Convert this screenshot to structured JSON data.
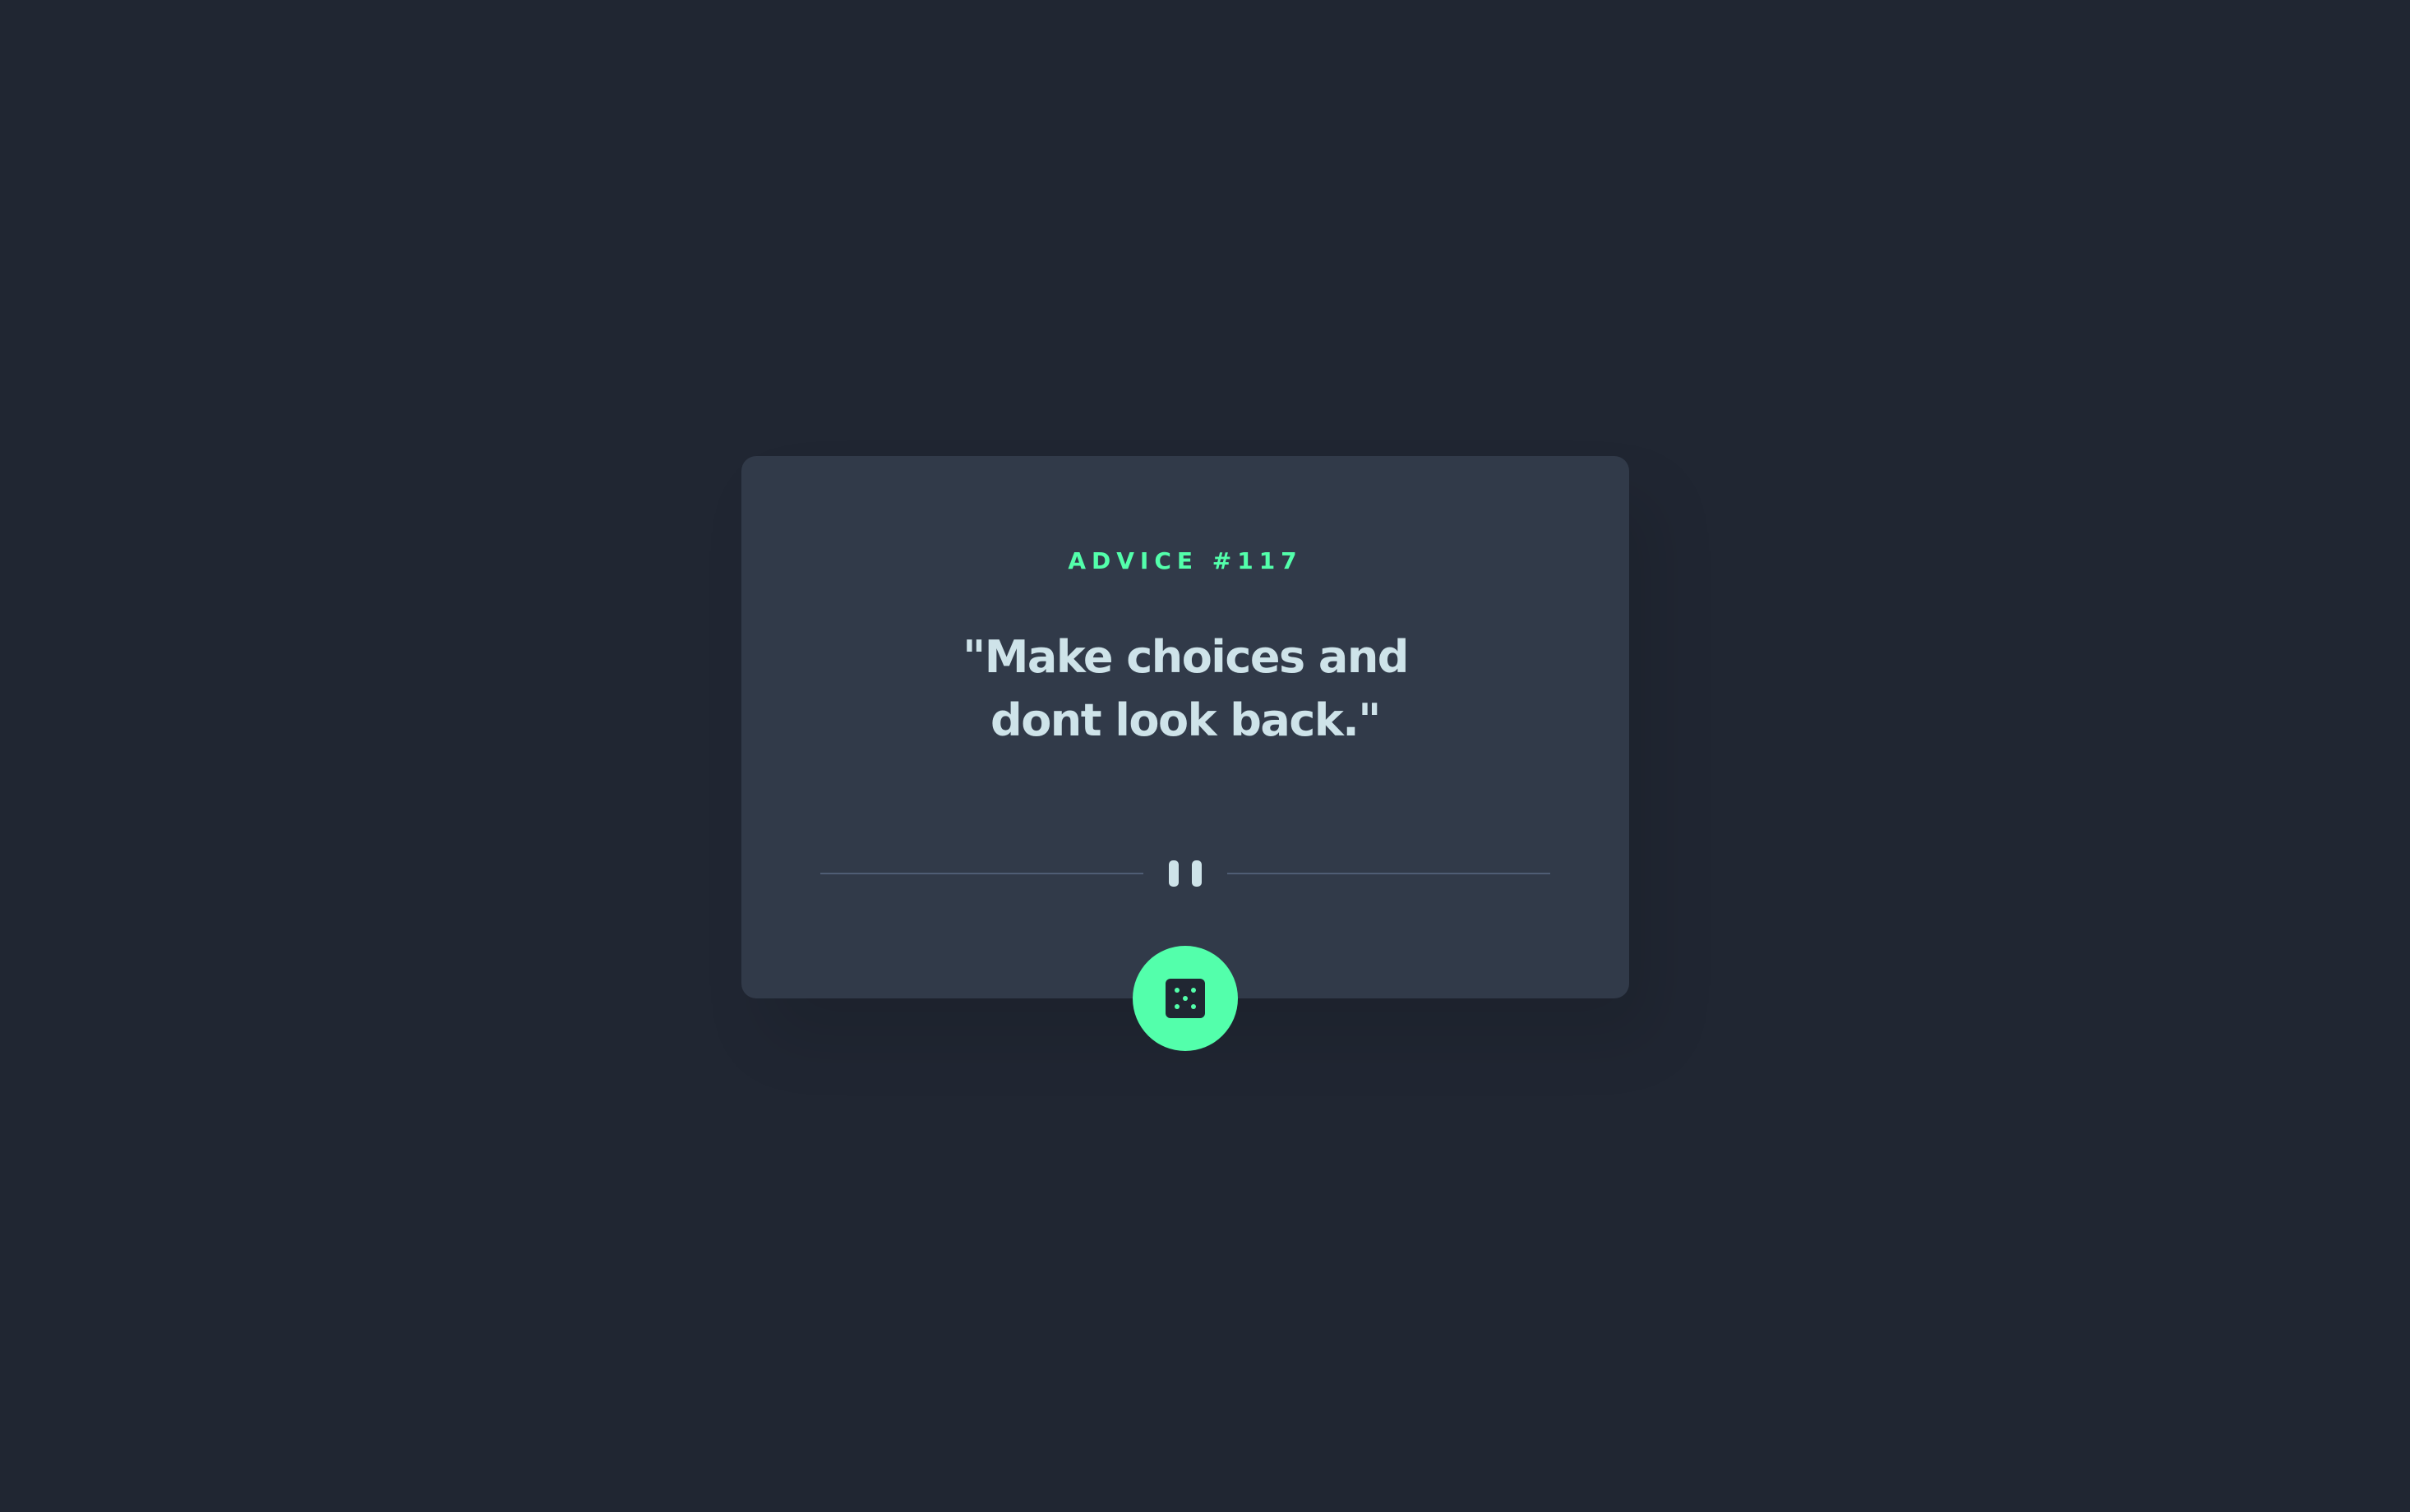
{
  "card": {
    "advice_label": "ADVICE #117",
    "quote": "\"Make choices and dont look back.\""
  },
  "divider": {
    "icon": "pause-icon"
  },
  "button": {
    "icon": "dice-icon"
  },
  "colors": {
    "background": "#202632",
    "card": "#313a49",
    "accent": "#53ffab",
    "text": "#cee3e9",
    "divider": "#4f5d74"
  }
}
